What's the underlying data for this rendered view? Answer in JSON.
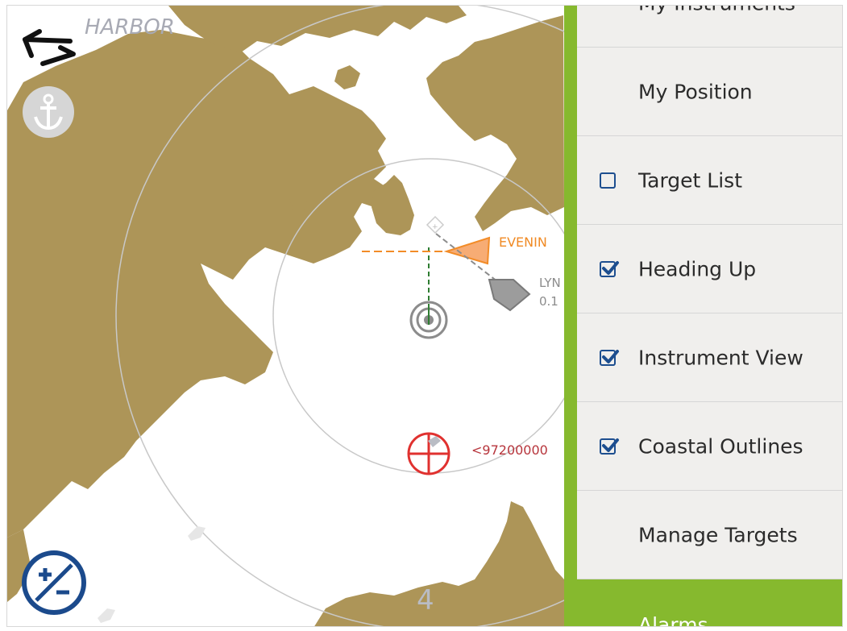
{
  "map": {
    "harbor_label": "HARBOR",
    "range_label": "4",
    "colors": {
      "land": "#ad9558",
      "water": "#ffffff",
      "own_target": "#f28c28",
      "alarm": "#e0312f",
      "menu_green": "#86b92e"
    }
  },
  "targets": {
    "evening_label": "EVENIN",
    "lyn_name": "LYN",
    "lyn_distance": "0.1",
    "mmsi_label": "<97200000"
  },
  "controls": {
    "back_icon": "back-arrows-icon",
    "anchor_icon": "anchor-icon",
    "zoom_icon": "zoom-plus-minus-icon"
  },
  "menu": {
    "items": [
      {
        "label": "My Instruments",
        "checkbox": false
      },
      {
        "label": "My Position",
        "checkbox": false
      },
      {
        "label": "Target List",
        "checkbox": true,
        "checked": false
      },
      {
        "label": "Heading Up",
        "checkbox": true,
        "checked": true
      },
      {
        "label": "Instrument View",
        "checkbox": true,
        "checked": true
      },
      {
        "label": "Coastal Outlines",
        "checkbox": true,
        "checked": true
      },
      {
        "label": "Manage Targets",
        "checkbox": false
      },
      {
        "label": "Alarms",
        "checkbox": false,
        "highlighted": true
      }
    ]
  }
}
